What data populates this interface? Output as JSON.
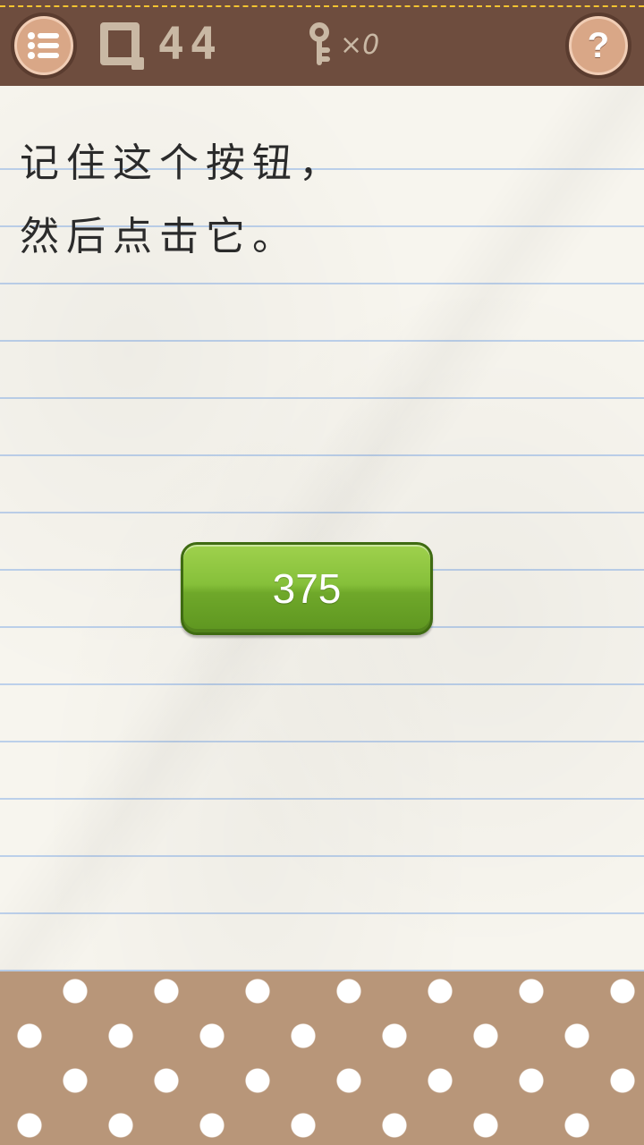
{
  "header": {
    "menu_icon": "list-menu-icon",
    "level_prefix_icon": "q-level-icon",
    "level_number": "44",
    "key_icon": "key-icon",
    "key_count": "×0",
    "help_label": "?"
  },
  "question": {
    "line1": "记住这个按钮，",
    "line2": "然后点击它。"
  },
  "button": {
    "label": "375",
    "color": "#86c03a"
  },
  "colors": {
    "topbar": "#6e4d3e",
    "stitch": "#f4c430",
    "bottom_pattern": "#b89679",
    "paper_lines": "#bcd0ea"
  }
}
